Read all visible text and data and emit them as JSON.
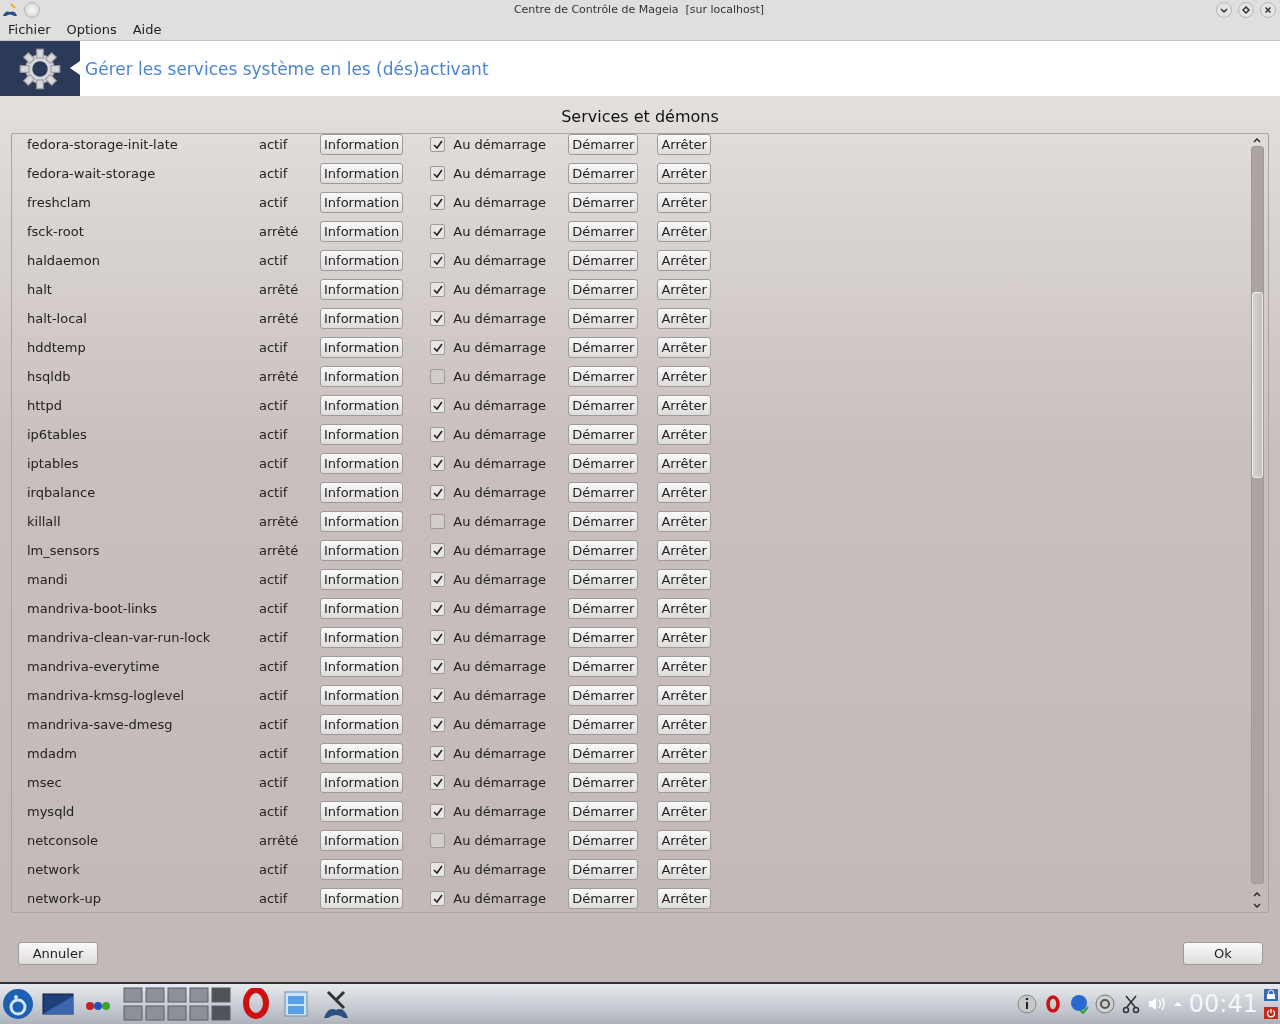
{
  "window": {
    "title": "Centre de Contrôle de Mageia  [sur localhost]"
  },
  "menu": [
    "Fichier",
    "Options",
    "Aide"
  ],
  "header": {
    "title": "Gérer les services système en les (dés)activant"
  },
  "section_title": "Services et démons",
  "services": [
    {
      "name": "fedora-storage-init-late",
      "status": "actif",
      "info": "Information",
      "boot": "Au démarrage",
      "checked": true,
      "start": "Démarrer",
      "stop": "Arrêter"
    },
    {
      "name": "fedora-wait-storage",
      "status": "actif",
      "info": "Information",
      "boot": "Au démarrage",
      "checked": true,
      "start": "Démarrer",
      "stop": "Arrêter"
    },
    {
      "name": "freshclam",
      "status": "actif",
      "info": "Information",
      "boot": "Au démarrage",
      "checked": true,
      "start": "Démarrer",
      "stop": "Arrêter"
    },
    {
      "name": "fsck-root",
      "status": "arrêté",
      "info": "Information",
      "boot": "Au démarrage",
      "checked": true,
      "start": "Démarrer",
      "stop": "Arrêter"
    },
    {
      "name": "haldaemon",
      "status": "actif",
      "info": "Information",
      "boot": "Au démarrage",
      "checked": true,
      "start": "Démarrer",
      "stop": "Arrêter"
    },
    {
      "name": "halt",
      "status": "arrêté",
      "info": "Information",
      "boot": "Au démarrage",
      "checked": true,
      "start": "Démarrer",
      "stop": "Arrêter"
    },
    {
      "name": "halt-local",
      "status": "arrêté",
      "info": "Information",
      "boot": "Au démarrage",
      "checked": true,
      "start": "Démarrer",
      "stop": "Arrêter"
    },
    {
      "name": "hddtemp",
      "status": "actif",
      "info": "Information",
      "boot": "Au démarrage",
      "checked": true,
      "start": "Démarrer",
      "stop": "Arrêter"
    },
    {
      "name": "hsqldb",
      "status": "arrêté",
      "info": "Information",
      "boot": "Au démarrage",
      "checked": false,
      "start": "Démarrer",
      "stop": "Arrêter"
    },
    {
      "name": "httpd",
      "status": "actif",
      "info": "Information",
      "boot": "Au démarrage",
      "checked": true,
      "start": "Démarrer",
      "stop": "Arrêter"
    },
    {
      "name": "ip6tables",
      "status": "actif",
      "info": "Information",
      "boot": "Au démarrage",
      "checked": true,
      "start": "Démarrer",
      "stop": "Arrêter"
    },
    {
      "name": "iptables",
      "status": "actif",
      "info": "Information",
      "boot": "Au démarrage",
      "checked": true,
      "start": "Démarrer",
      "stop": "Arrêter"
    },
    {
      "name": "irqbalance",
      "status": "actif",
      "info": "Information",
      "boot": "Au démarrage",
      "checked": true,
      "start": "Démarrer",
      "stop": "Arrêter"
    },
    {
      "name": "killall",
      "status": "arrêté",
      "info": "Information",
      "boot": "Au démarrage",
      "checked": false,
      "start": "Démarrer",
      "stop": "Arrêter"
    },
    {
      "name": "lm_sensors",
      "status": "arrêté",
      "info": "Information",
      "boot": "Au démarrage",
      "checked": true,
      "start": "Démarrer",
      "stop": "Arrêter"
    },
    {
      "name": "mandi",
      "status": "actif",
      "info": "Information",
      "boot": "Au démarrage",
      "checked": true,
      "start": "Démarrer",
      "stop": "Arrêter"
    },
    {
      "name": "mandriva-boot-links",
      "status": "actif",
      "info": "Information",
      "boot": "Au démarrage",
      "checked": true,
      "start": "Démarrer",
      "stop": "Arrêter"
    },
    {
      "name": "mandriva-clean-var-run-lock",
      "status": "actif",
      "info": "Information",
      "boot": "Au démarrage",
      "checked": true,
      "start": "Démarrer",
      "stop": "Arrêter"
    },
    {
      "name": "mandriva-everytime",
      "status": "actif",
      "info": "Information",
      "boot": "Au démarrage",
      "checked": true,
      "start": "Démarrer",
      "stop": "Arrêter"
    },
    {
      "name": "mandriva-kmsg-loglevel",
      "status": "actif",
      "info": "Information",
      "boot": "Au démarrage",
      "checked": true,
      "start": "Démarrer",
      "stop": "Arrêter"
    },
    {
      "name": "mandriva-save-dmesg",
      "status": "actif",
      "info": "Information",
      "boot": "Au démarrage",
      "checked": true,
      "start": "Démarrer",
      "stop": "Arrêter"
    },
    {
      "name": "mdadm",
      "status": "actif",
      "info": "Information",
      "boot": "Au démarrage",
      "checked": true,
      "start": "Démarrer",
      "stop": "Arrêter"
    },
    {
      "name": "msec",
      "status": "actif",
      "info": "Information",
      "boot": "Au démarrage",
      "checked": true,
      "start": "Démarrer",
      "stop": "Arrêter"
    },
    {
      "name": "mysqld",
      "status": "actif",
      "info": "Information",
      "boot": "Au démarrage",
      "checked": true,
      "start": "Démarrer",
      "stop": "Arrêter"
    },
    {
      "name": "netconsole",
      "status": "arrêté",
      "info": "Information",
      "boot": "Au démarrage",
      "checked": false,
      "start": "Démarrer",
      "stop": "Arrêter"
    },
    {
      "name": "network",
      "status": "actif",
      "info": "Information",
      "boot": "Au démarrage",
      "checked": true,
      "start": "Démarrer",
      "stop": "Arrêter"
    },
    {
      "name": "network-up",
      "status": "actif",
      "info": "Information",
      "boot": "Au démarrage",
      "checked": true,
      "start": "Démarrer",
      "stop": "Arrêter"
    }
  ],
  "buttons": {
    "cancel": "Annuler",
    "ok": "Ok"
  },
  "taskbar": {
    "clock": "00:41"
  }
}
